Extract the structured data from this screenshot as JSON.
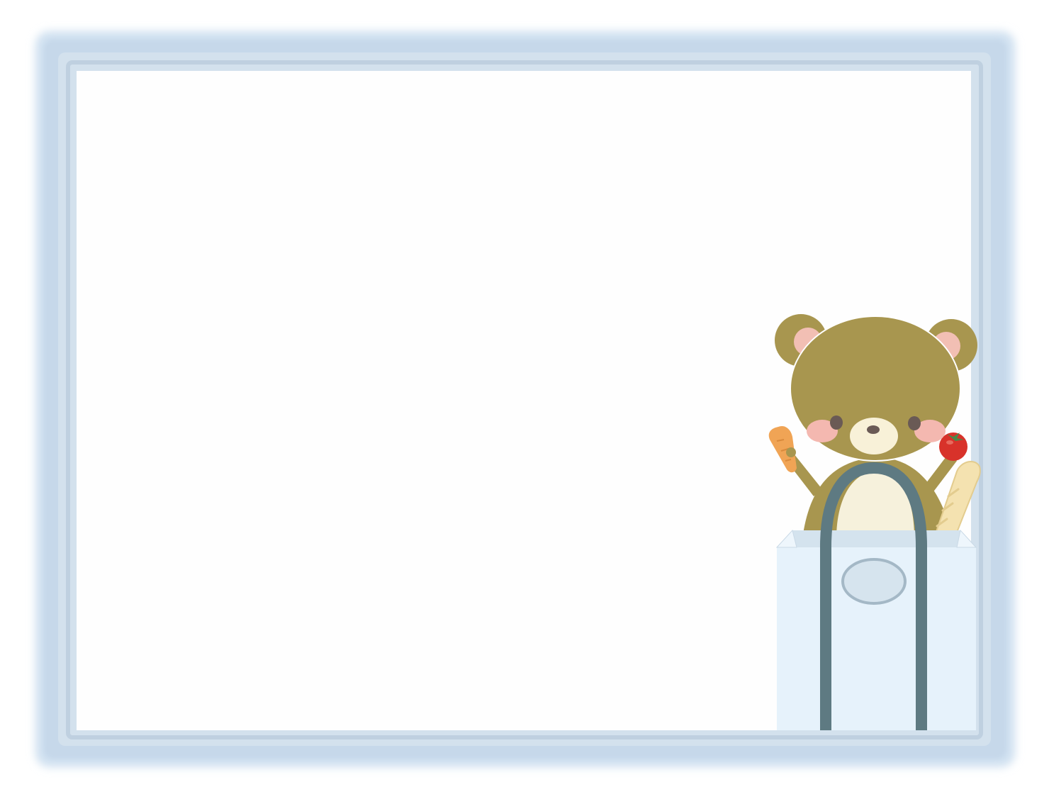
{
  "frame": {
    "style": "soft-blue-border",
    "colors": {
      "outer_glow": "#cfe0f0",
      "outer_band": "#c3d6e8",
      "inner_band": "#d4e2ee",
      "inner_line": "#bccfe0",
      "panel": "#fefefe"
    }
  },
  "illustration": {
    "subject": "bear-in-shopping-bag",
    "icons": [
      "bear-icon",
      "carrot-icon",
      "tomato-icon",
      "baguette-icon",
      "shopping-bag-icon"
    ],
    "colors": {
      "fur": "#a8964f",
      "inner_ear": "#f2bfb4",
      "muzzle": "#f8f1d8",
      "belly": "#f6f1dc",
      "eye": "#6a5a55",
      "cheek": "#f4b8b0",
      "carrot": "#f0a455",
      "tomato": "#d8322a",
      "tomato_stem": "#4a8a4a",
      "bread": "#f4e2b0",
      "bag": "#e6f2fb",
      "bag_inside": "#d4e3ee",
      "bag_handle": "#5e7a82",
      "bag_label": "#d6e4ee",
      "bag_label_border": "#a4b8c6"
    }
  }
}
